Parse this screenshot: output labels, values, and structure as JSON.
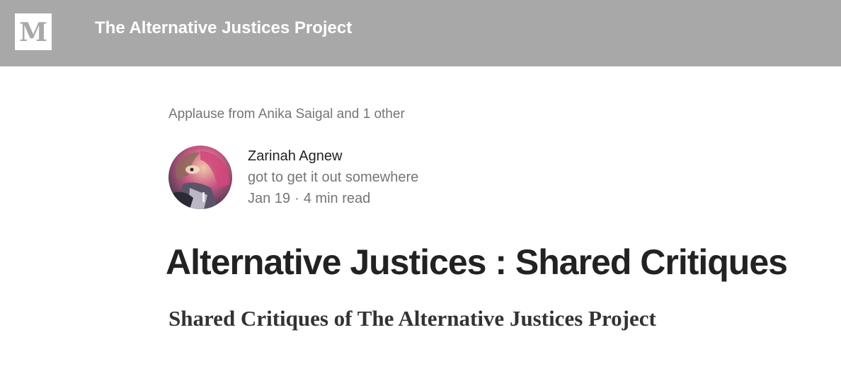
{
  "header": {
    "logo_letter": "M",
    "publication_name": "The Alternative Justices Project",
    "background_color": "#a8a8a8"
  },
  "post": {
    "applause_text": "Applause from Anika Saigal and 1 other",
    "author": {
      "name": "Zarinah Agnew",
      "bio": "got to get it out somewhere",
      "avatar_icon": "author-avatar"
    },
    "meta": {
      "date": "Jan 19",
      "separator": "·",
      "read_time": "4 min read"
    },
    "title": "Alternative Justices : Shared Critiques",
    "subtitle": "Shared Critiques of The Alternative Justices Project"
  }
}
